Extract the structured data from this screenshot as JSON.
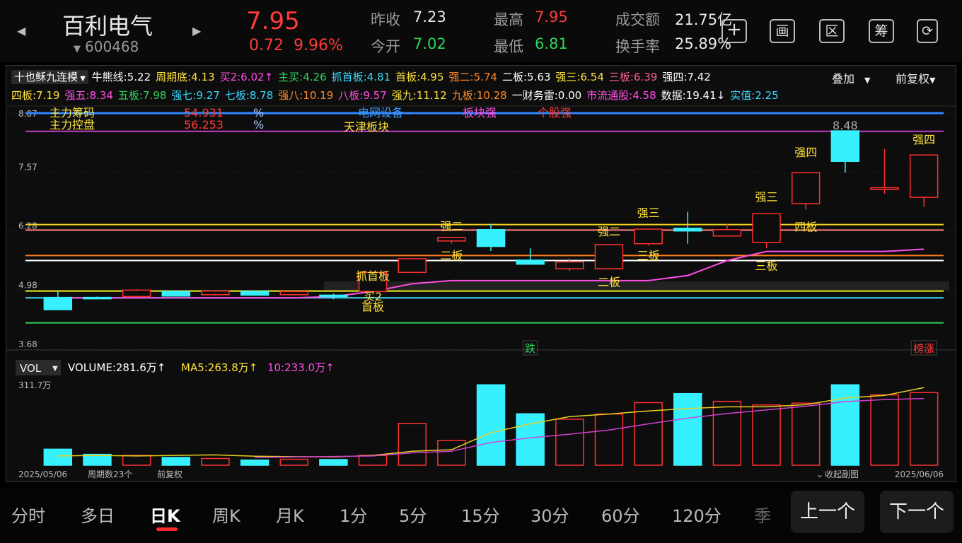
{
  "header": {
    "name": "百利电气",
    "code": "600468",
    "price": "7.95",
    "change_abs": "0.72",
    "change_pct": "9.96%",
    "quotes": {
      "prev_close_label": "昨收",
      "prev_close": "7.23",
      "open_label": "今开",
      "open": "7.02",
      "high_label": "最高",
      "high": "7.95",
      "low_label": "最低",
      "low": "6.81",
      "turnover_label": "成交额",
      "turnover": "21.75亿",
      "turnover_rate_label": "换手率",
      "turnover_rate": "25.89%"
    },
    "tools": [
      "画",
      "区",
      "筹"
    ]
  },
  "indicator": {
    "name": "十也稣九连模",
    "overlay": "叠加",
    "adjust": "前复权",
    "line1": [
      {
        "t": "牛熊线:5.22",
        "c": "#ffffff"
      },
      {
        "t": "周期底:4.13",
        "c": "#ffe23a"
      },
      {
        "t": "买2:6.02↑",
        "c": "#ff4ee4"
      },
      {
        "t": "主买:4.26",
        "c": "#2fd45b"
      },
      {
        "t": "抓首板:4.81",
        "c": "#3ad8ff"
      },
      {
        "t": "首板:4.95",
        "c": "#ffe23a"
      },
      {
        "t": "强二:5.74",
        "c": "#ff8a2a"
      },
      {
        "t": "二板:5.63",
        "c": "#ffffff"
      },
      {
        "t": "强三:6.54",
        "c": "#ffe23a"
      },
      {
        "t": "三板:6.39",
        "c": "#ff5e9a"
      },
      {
        "t": "强四:7.42",
        "c": "#ffffff"
      }
    ],
    "line2": [
      {
        "t": "四板:7.19",
        "c": "#ffe23a"
      },
      {
        "t": "强五:8.34",
        "c": "#ff4ee4"
      },
      {
        "t": "五板:7.98",
        "c": "#2fd45b"
      },
      {
        "t": "强七:9.27",
        "c": "#3ad8ff"
      },
      {
        "t": "七板:8.78",
        "c": "#3ad8ff"
      },
      {
        "t": "强八:10.19",
        "c": "#ff8a2a"
      },
      {
        "t": "八板:9.57",
        "c": "#ff4ee4"
      },
      {
        "t": "强九:11.12",
        "c": "#ffe23a"
      },
      {
        "t": "九板:10.28",
        "c": "#ff8a2a"
      },
      {
        "t": "一财务雷:0.00",
        "c": "#ffffff"
      },
      {
        "t": "市流通股:4.58",
        "c": "#ff4ee4"
      },
      {
        "t": "数据:19.41↓",
        "c": "#ffffff"
      },
      {
        "t": "实值:2.25",
        "c": "#3ad8ff"
      }
    ]
  },
  "chart_data": {
    "type": "candlestick",
    "y_ticks": [
      "8.87",
      "7.57",
      "6.28",
      "4.98",
      "3.68"
    ],
    "ylim": [
      3.68,
      8.87
    ],
    "candles": [
      {
        "o": 4.55,
        "c": 4.82,
        "h": 4.95,
        "l": 4.55,
        "up": false
      },
      {
        "o": 4.8,
        "c": 4.82,
        "h": 4.84,
        "l": 4.78,
        "up": false
      },
      {
        "o": 4.84,
        "c": 4.98,
        "h": 5.0,
        "l": 4.84,
        "up": true
      },
      {
        "o": 4.95,
        "c": 4.85,
        "h": 4.97,
        "l": 4.84,
        "up": false
      },
      {
        "o": 4.88,
        "c": 4.96,
        "h": 4.97,
        "l": 4.86,
        "up": true
      },
      {
        "o": 4.95,
        "c": 4.87,
        "h": 4.97,
        "l": 4.86,
        "up": false
      },
      {
        "o": 4.88,
        "c": 4.95,
        "h": 4.96,
        "l": 4.86,
        "up": true
      },
      {
        "o": 4.87,
        "c": 4.84,
        "h": 4.9,
        "l": 4.78,
        "up": false
      },
      {
        "o": 4.95,
        "c": 5.37,
        "h": 5.37,
        "l": 4.95,
        "up": true
      },
      {
        "o": 5.37,
        "c": 5.67,
        "h": 5.67,
        "l": 5.37,
        "up": true
      },
      {
        "o": 6.06,
        "c": 6.14,
        "h": 6.14,
        "l": 6.0,
        "up": true
      },
      {
        "o": 6.31,
        "c": 5.94,
        "h": 6.44,
        "l": 5.84,
        "up": false
      },
      {
        "o": 5.64,
        "c": 5.55,
        "h": 5.9,
        "l": 5.55,
        "up": false
      },
      {
        "o": 5.45,
        "c": 5.6,
        "h": 5.68,
        "l": 5.4,
        "up": true
      },
      {
        "o": 5.45,
        "c": 5.98,
        "h": 5.98,
        "l": 5.45,
        "up": true
      },
      {
        "o": 6.0,
        "c": 6.32,
        "h": 6.32,
        "l": 5.96,
        "up": true
      },
      {
        "o": 6.34,
        "c": 6.28,
        "h": 6.7,
        "l": 6.0,
        "up": false
      },
      {
        "o": 6.17,
        "c": 6.31,
        "h": 6.44,
        "l": 6.17,
        "up": true
      },
      {
        "o": 6.03,
        "c": 6.66,
        "h": 6.66,
        "l": 5.9,
        "up": true
      },
      {
        "o": 6.88,
        "c": 7.56,
        "h": 7.56,
        "l": 6.75,
        "up": true
      },
      {
        "o": 8.48,
        "c": 7.81,
        "h": 8.48,
        "l": 7.56,
        "up": false
      },
      {
        "o": 7.19,
        "c": 7.23,
        "h": 8.08,
        "l": 7.1,
        "up": true
      },
      {
        "o": 7.02,
        "c": 7.95,
        "h": 7.95,
        "l": 6.81,
        "up": true
      }
    ],
    "h_lines": [
      {
        "v": 8.87,
        "color": "#2f86ff"
      },
      {
        "v": 8.47,
        "color": "#c23ec8"
      },
      {
        "v": 6.42,
        "color": "#f0d020"
      },
      {
        "v": 6.3,
        "color": "#ff8080"
      },
      {
        "v": 5.74,
        "color": "#ff7a1a"
      },
      {
        "v": 5.63,
        "color": "#ffffff"
      },
      {
        "v": 4.96,
        "color": "#f0f020"
      },
      {
        "v": 4.81,
        "color": "#3ad8ff"
      },
      {
        "v": 4.26,
        "color": "#2fd45b"
      }
    ],
    "band": [
      4.98,
      5.17
    ],
    "stair_line": [
      4.81,
      4.81,
      4.81,
      4.81,
      4.81,
      4.81,
      4.81,
      4.84,
      4.95,
      5.12,
      5.19,
      5.19,
      5.19,
      5.19,
      5.19,
      5.19,
      5.3,
      5.63,
      5.83,
      5.83,
      5.83,
      5.83,
      5.88
    ],
    "labels": [
      {
        "t": "抓首板",
        "i": 8,
        "v": 5.2,
        "c": "#ffe23a"
      },
      {
        "t": "买2",
        "i": 8,
        "v": 4.75,
        "c": "#ffe23a"
      },
      {
        "t": "首板",
        "i": 8,
        "v": 4.53,
        "c": "#ffe23a"
      },
      {
        "t": "强二",
        "i": 10,
        "v": 6.3,
        "c": "#ffe23a"
      },
      {
        "t": "二板",
        "i": 10,
        "v": 5.65,
        "c": "#ffe23a"
      },
      {
        "t": "强二",
        "i": 14,
        "v": 6.18,
        "c": "#ffe23a"
      },
      {
        "t": "二板",
        "i": 14,
        "v": 5.07,
        "c": "#ffe23a"
      },
      {
        "t": "强三",
        "i": 15,
        "v": 6.59,
        "c": "#ffe23a"
      },
      {
        "t": "三板",
        "i": 15,
        "v": 5.65,
        "c": "#ffe23a"
      },
      {
        "t": "强三",
        "i": 18,
        "v": 6.94,
        "c": "#ffe23a"
      },
      {
        "t": "三板",
        "i": 18,
        "v": 5.43,
        "c": "#ffe23a"
      },
      {
        "t": "四板",
        "i": 19,
        "v": 6.28,
        "c": "#ffe23a"
      },
      {
        "t": "强四",
        "i": 19,
        "v": 7.92,
        "c": "#ffe23a"
      },
      {
        "t": "强四",
        "i": 22,
        "v": 8.2,
        "c": "#ffe23a"
      },
      {
        "t": "8.48",
        "i": 20,
        "v": 8.51,
        "c": "#aaaaaa"
      }
    ],
    "overlay_text": {
      "r1_label": "主力筹码",
      "r1_val": "54.931",
      "r1_pct": "%",
      "r2_label": "主力控盘",
      "r2_val": "56.253",
      "r2_pct": "%",
      "sector1": "电网设备 -",
      "sector1b": "板块强",
      "sector1c": "个股强",
      "sector2": "天津板块"
    },
    "bottom_marks": [
      {
        "t": "跌",
        "i": 12,
        "c": "#2fd45b"
      },
      {
        "t": "榜涨",
        "i": 22,
        "c": "#ff3b3b"
      }
    ],
    "volume": {
      "label": "VOL",
      "volume_text": "VOLUME:281.6万↑",
      "ma5_text": "MA5:263.8万↑",
      "ma10_text": "10:233.0万↑",
      "max_tick": "311.7万",
      "values": [
        62,
        42,
        38,
        30,
        26,
        20,
        23,
        22,
        38,
        162,
        96,
        311,
        199,
        178,
        198,
        242,
        277,
        247,
        233,
        240,
        311,
        272,
        281
      ],
      "ma5": [
        36,
        38,
        36,
        38,
        40,
        35,
        33,
        32,
        38,
        54,
        60,
        126,
        160,
        188,
        198,
        210,
        219,
        226,
        226,
        234,
        260,
        270,
        300
      ],
      "ma10": [
        null,
        null,
        null,
        null,
        null,
        30,
        32,
        34,
        36,
        48,
        54,
        88,
        106,
        120,
        136,
        160,
        182,
        200,
        214,
        228,
        246,
        254,
        258
      ]
    },
    "dates": {
      "start": "2025/05/06",
      "end": "2025/06/06"
    },
    "footer": {
      "period": "周期数23个",
      "adjust": "前复权",
      "collapse": "收起副图"
    }
  },
  "nav": {
    "tabs": [
      "分时",
      "多日",
      "日K",
      "周K",
      "月K",
      "1分",
      "5分",
      "15分",
      "30分",
      "60分",
      "120分",
      "季"
    ],
    "active": "日K",
    "prev": "上一个",
    "next": "下一个"
  }
}
